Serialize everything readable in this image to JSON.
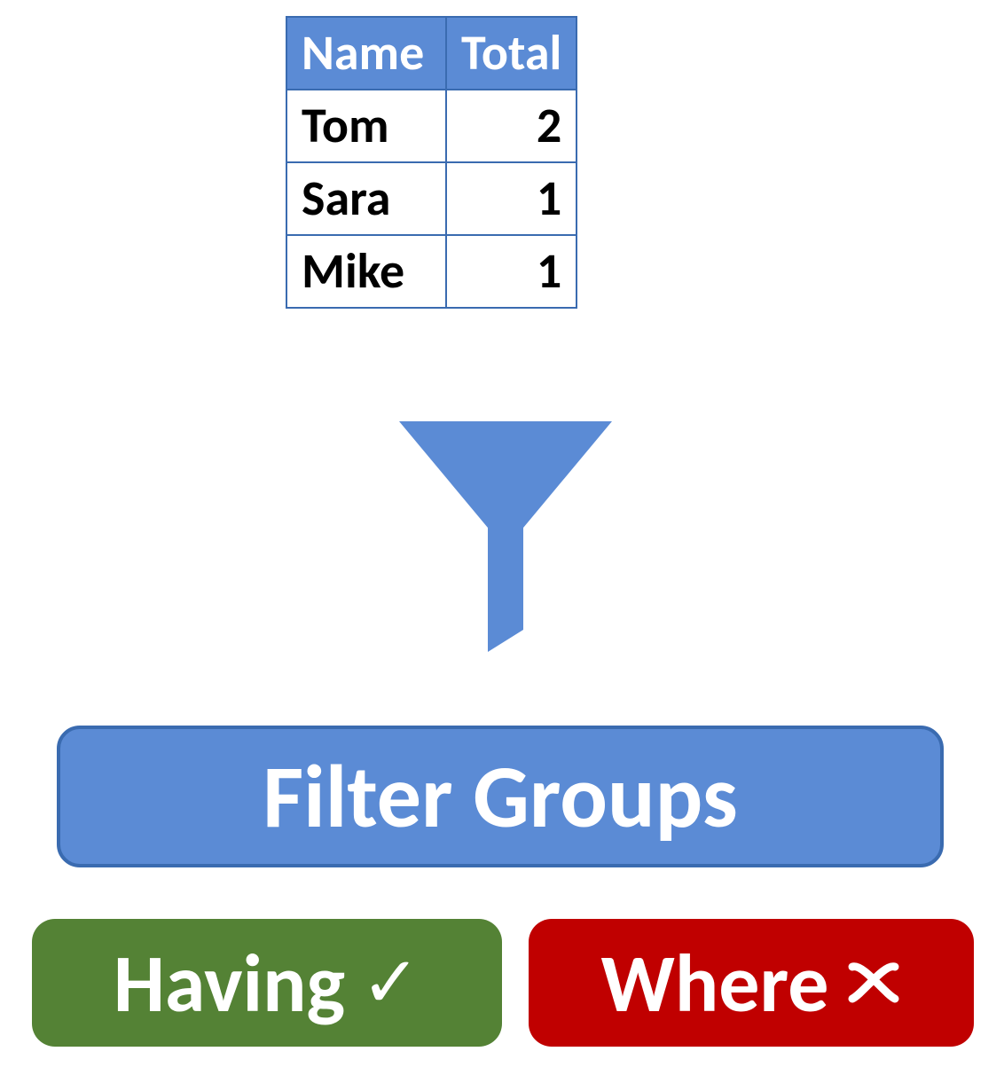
{
  "table": {
    "headers": {
      "name": "Name",
      "total": "Total"
    },
    "rows": [
      {
        "name": "Tom",
        "total": "2"
      },
      {
        "name": "Sara",
        "total": "1"
      },
      {
        "name": "Mike",
        "total": "1"
      }
    ]
  },
  "funnel": {
    "icon_name": "funnel-icon",
    "color": "#5B8BD5"
  },
  "filter_groups": {
    "label": "Filter Groups",
    "bg": "#5B8BD5"
  },
  "having": {
    "label": "Having",
    "mark": "✓",
    "bg": "#548235"
  },
  "where": {
    "label": "Where",
    "mark": "✗",
    "bg": "#C00000"
  }
}
